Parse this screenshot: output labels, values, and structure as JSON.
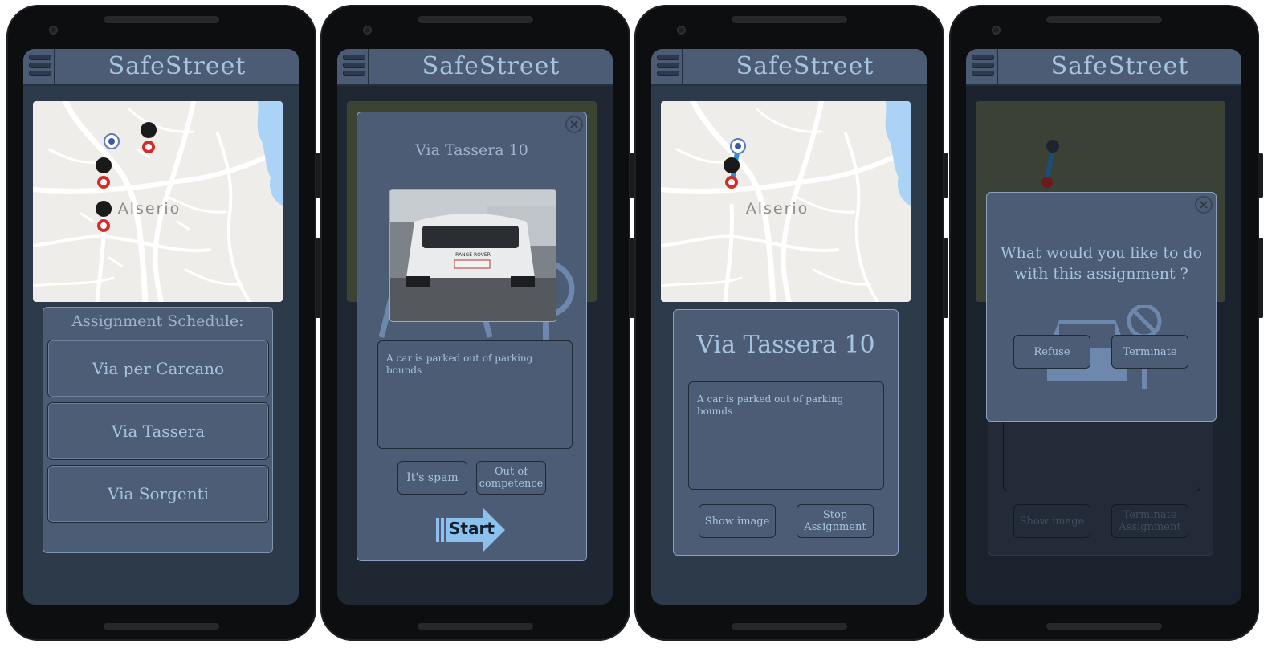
{
  "app": {
    "title": "SafeStreet"
  },
  "map": {
    "town_label": "Alserio"
  },
  "screen1": {
    "schedule_title": "Assignment Schedule:",
    "items": [
      "Via per Carcano",
      "Via Tassera",
      "Via Sorgenti"
    ]
  },
  "screen2": {
    "dialog_title": "Via Tassera 10",
    "description": "A car is parked out of parking bounds",
    "spam_label": "It's spam",
    "competence_label": "Out of competence",
    "start_label": "Start"
  },
  "screen3": {
    "street_title": "Via Tassera 10",
    "description": "A car is parked out of parking bounds",
    "show_image_label": "Show image",
    "stop_label": "Stop Assignment"
  },
  "screen4": {
    "question": "What would you like to do with this assignment ?",
    "refuse_label": "Refuse",
    "terminate_label": "Terminate",
    "bg_show_image_label": "Show image",
    "bg_terminate_label": "Terminate Assignment"
  },
  "colors": {
    "header": "#4b5c74",
    "screen_bg": "#2d3a4a",
    "accent_text": "#a6c4e2",
    "route": "#2f8fd8",
    "marker": "#d42b2b",
    "water": "#aad3f5"
  }
}
